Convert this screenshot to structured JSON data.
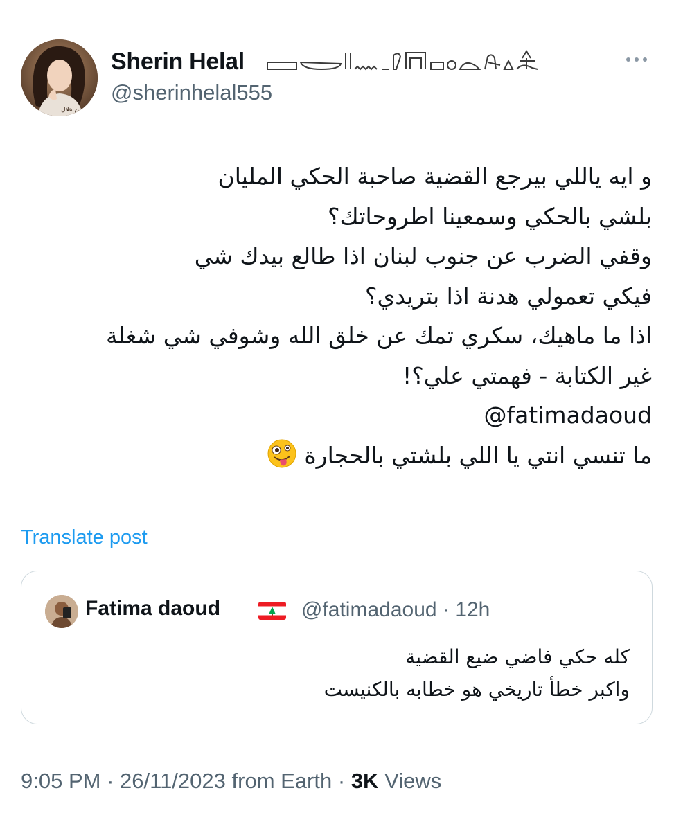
{
  "author": {
    "name": "Sherin Helal",
    "handle": "@sherinhelal555",
    "avatar_signature": "شيرين هلال"
  },
  "post": {
    "lines": [
      "و ايه ياللي بيرجع القضية صاحبة الحكي المليان",
      "بلشي بالحكي وسمعينا اطروحاتك؟",
      "وقفي الضرب عن جنوب لبنان اذا طالع بيدك شي",
      "فيكي تعمولي هدنة اذا بتريدي؟",
      "اذا ما ماهيك، سكري تمك عن خلق الله وشوفي شي شغلة",
      "غير الكتابة - فهمتي علي؟!"
    ],
    "mention": "@fatimadaoud",
    "last_line": "ما تنسي انتي يا اللي بلشتي بالحجارة",
    "emoji": "zany-face"
  },
  "translate_label": "Translate post",
  "quote": {
    "name": "Fatima daoud",
    "flag": "lebanon-flag",
    "handle": "@fatimadaoud",
    "separator": "·",
    "time": "12h",
    "lines": [
      "كله حكي فاضي ضيع القضية",
      "واكبر خطأ تاريخي هو خطابه بالكنيست"
    ]
  },
  "footer": {
    "time": "9:05 PM",
    "sep1": "·",
    "date": "26/11/2023",
    "source": "from Earth",
    "sep2": "·",
    "views_count": "3K",
    "views_label": "Views"
  },
  "colors": {
    "link": "#1d9bf0",
    "secondary_text": "#536471",
    "primary_text": "#0f1419",
    "border": "#cfd9de"
  }
}
